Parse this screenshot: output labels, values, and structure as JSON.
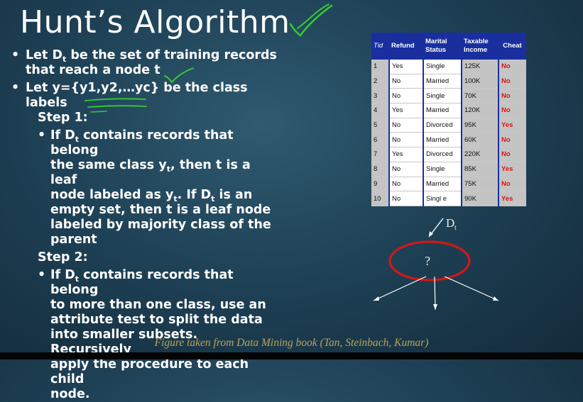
{
  "title": "Hunt’s Algorithm",
  "bullets": {
    "b1_line1": "Let D",
    "b1_sub": "t",
    "b1_line1_rest": " be the set of training records",
    "b1_line2": "that reach a node t",
    "b2_line1": "Let y={y1,y2,…yc} be the class labels",
    "step1": "Step 1:",
    "s1_part1": "If D",
    "s1_sub1": "t",
    "s1_part2": " contains records that belong",
    "s1_part3": "the same class y",
    "s1_sub2": "t",
    "s1_part4": ", then t is a leaf",
    "s1_part5": "node labeled as y",
    "s1_sub3": "t",
    "s1_part6": ". If D",
    "s1_sub4": "t",
    "s1_part7": " is an",
    "s1_part8": "empty set, then t is a leaf node",
    "s1_part9": "labeled by majority class of the",
    "s1_part10": "parent",
    "step2": "Step 2:",
    "s2_part1": "If D",
    "s2_sub1": "t",
    "s2_part2": " contains records that belong",
    "s2_part3": "to more than one class, use an",
    "s2_part4": "attribute test to split the data",
    "s2_part5": "into smaller subsets. Recursively",
    "s2_part6": "apply the procedure to each child",
    "s2_part7": "node."
  },
  "table": {
    "headers": {
      "tid": "Tid",
      "refund": "Refund",
      "marital_1": "Marital",
      "marital_2": "Status",
      "income_1": "Taxable",
      "income_2": "Income",
      "cheat": "Cheat"
    },
    "rows": [
      [
        "1",
        "Yes",
        "Single",
        "125K",
        "No"
      ],
      [
        "2",
        "No",
        "Married",
        "100K",
        "No"
      ],
      [
        "3",
        "No",
        "Single",
        "70K",
        "No"
      ],
      [
        "4",
        "Yes",
        "Married",
        "120K",
        "No"
      ],
      [
        "5",
        "No",
        "Divorced",
        "95K",
        "Yes"
      ],
      [
        "6",
        "No",
        "Married",
        "60K",
        "No"
      ],
      [
        "7",
        "Yes",
        "Divorced",
        "220K",
        "No"
      ],
      [
        "8",
        "No",
        "Single",
        "85K",
        "Yes"
      ],
      [
        "9",
        "No",
        "Married",
        "75K",
        "No"
      ],
      [
        "10",
        "No",
        "Singl e",
        "90K",
        "Yes"
      ]
    ]
  },
  "diagram": {
    "dt_label": "D",
    "dt_sub": "t",
    "node_label": "?"
  },
  "caption": "Figure taken from Data Mining book (Tan, Steinbach, Kumar)",
  "colors": {
    "header_blue": "#1a2f9e",
    "cheat_red": "#e01010",
    "annotation_green": "#33cc33",
    "ellipse_red": "#d01818",
    "caption_gold": "#b9a35c"
  }
}
